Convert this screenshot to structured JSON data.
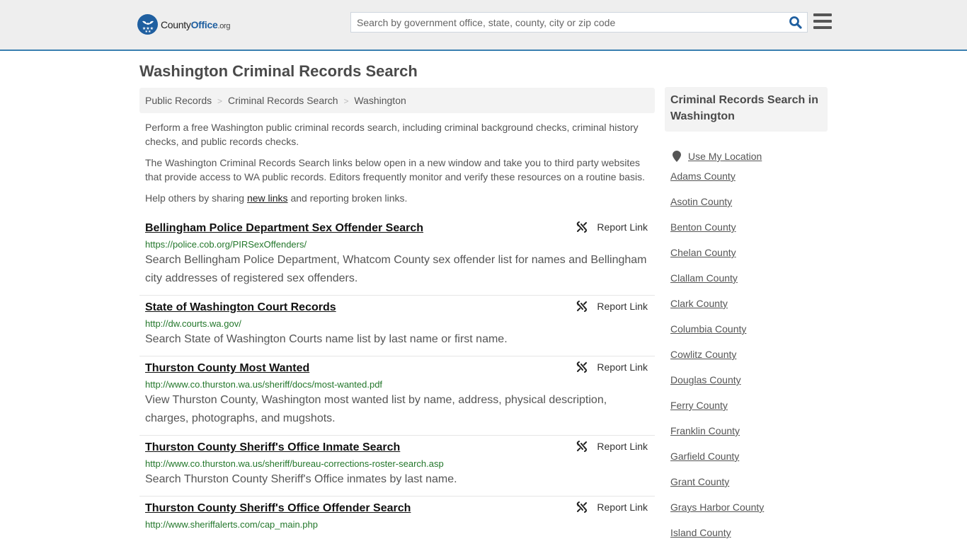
{
  "header": {
    "logo": {
      "name_part1": "County",
      "name_part2": "Office",
      "name_part3": ".org"
    },
    "search": {
      "placeholder": "Search by government office, state, county, city or zip code",
      "value": ""
    },
    "colors": {
      "brand_blue": "#1f5fa0",
      "header_bg": "#eeeeee",
      "header_border": "#3a7fb0"
    }
  },
  "page": {
    "title": "Washington Criminal Records Search"
  },
  "breadcrumb": [
    {
      "label": "Public Records"
    },
    {
      "label": "Criminal Records Search"
    },
    {
      "label": "Washington"
    }
  ],
  "breadcrumb_separator": ">",
  "intro": {
    "p1": "Perform a free Washington public criminal records search, including criminal background checks, criminal history checks, and public records checks.",
    "p2": "The Washington Criminal Records Search links below open in a new window and take you to third party websites that provide access to WA public records. Editors frequently monitor and verify these resources on a routine basis.",
    "p3_before": "Help others by sharing ",
    "p3_link": "new links",
    "p3_after": " and reporting broken links."
  },
  "report_label": "Report Link",
  "results": [
    {
      "title": "Bellingham Police Department Sex Offender Search",
      "url": "https://police.cob.org/PIRSexOffenders/",
      "description": "Search Bellingham Police Department, Whatcom County sex offender list for names and Bellingham city addresses of registered sex offenders."
    },
    {
      "title": "State of Washington Court Records",
      "url": "http://dw.courts.wa.gov/",
      "description": "Search State of Washington Courts name list by last name or first name."
    },
    {
      "title": "Thurston County Most Wanted",
      "url": "http://www.co.thurston.wa.us/sheriff/docs/most-wanted.pdf",
      "description": "View Thurston County, Washington most wanted list by name, address, physical description, charges, photographs, and mugshots."
    },
    {
      "title": "Thurston County Sheriff's Office Inmate Search",
      "url": "http://www.co.thurston.wa.us/sheriff/bureau-corrections-roster-search.asp",
      "description": "Search Thurston County Sheriff's Office inmates by last name."
    },
    {
      "title": "Thurston County Sheriff's Office Offender Search",
      "url": "http://www.sheriffalerts.com/cap_main.php",
      "description": ""
    }
  ],
  "sidebar": {
    "heading": "Criminal Records Search in Washington",
    "use_location": "Use My Location",
    "counties": [
      "Adams County",
      "Asotin County",
      "Benton County",
      "Chelan County",
      "Clallam County",
      "Clark County",
      "Columbia County",
      "Cowlitz County",
      "Douglas County",
      "Ferry County",
      "Franklin County",
      "Garfield County",
      "Grant County",
      "Grays Harbor County",
      "Island County"
    ]
  }
}
